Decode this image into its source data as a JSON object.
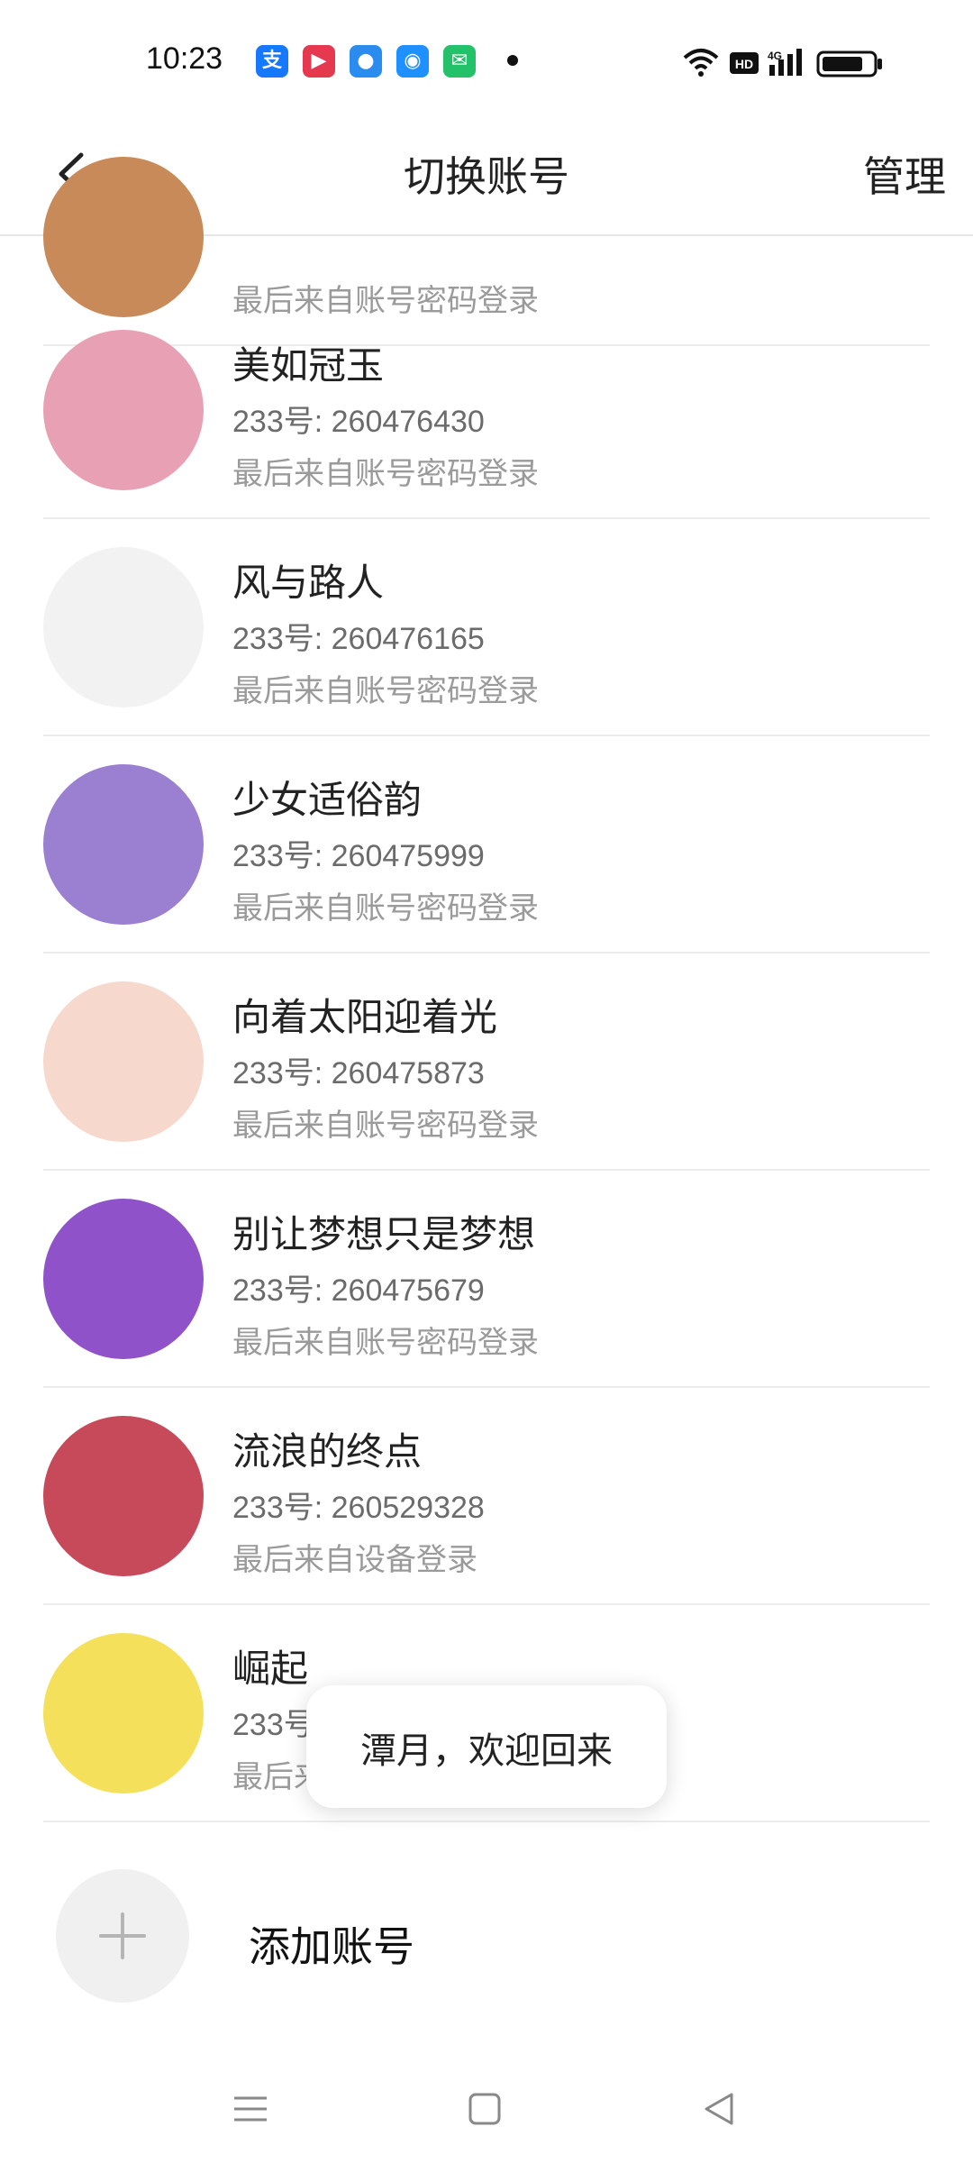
{
  "status_bar": {
    "time": "10:23",
    "apps": [
      {
        "name": "alipay-icon",
        "color": "#1677ff",
        "glyph": "支"
      },
      {
        "name": "video-app-icon",
        "color": "#e53950",
        "glyph": "▶"
      },
      {
        "name": "dot-app-icon",
        "color": "#2b8cf0",
        "glyph": "●"
      },
      {
        "name": "browser-app-icon",
        "color": "#1e90ff",
        "glyph": "◉"
      },
      {
        "name": "chat-app-icon",
        "color": "#24c16b",
        "glyph": "✉"
      }
    ],
    "network": "4G",
    "hd": "HD"
  },
  "header": {
    "title": "切换账号",
    "manage_label": "管理"
  },
  "accounts": [
    {
      "name": "",
      "uid": "",
      "last_login": "最后来自账号密码登录",
      "avatar_color": "#c98a5a"
    },
    {
      "name": "美如冠玉",
      "uid": "233号: 260476430",
      "last_login": "最后来自账号密码登录",
      "avatar_color": "#e8a0b4"
    },
    {
      "name": "风与路人",
      "uid": "233号: 260476165",
      "last_login": "最后来自账号密码登录",
      "avatar_color": "#f2f2f2"
    },
    {
      "name": "少女适俗韵",
      "uid": "233号: 260475999",
      "last_login": "最后来自账号密码登录",
      "avatar_color": "#9b7fd0"
    },
    {
      "name": "向着太阳迎着光",
      "uid": "233号: 260475873",
      "last_login": "最后来自账号密码登录",
      "avatar_color": "#f6d8cc"
    },
    {
      "name": "别让梦想只是梦想",
      "uid": "233号: 260475679",
      "last_login": "最后来自账号密码登录",
      "avatar_color": "#8f52c8"
    },
    {
      "name": "流浪的终点",
      "uid": "233号: 260529328",
      "last_login": "最后来自设备登录",
      "avatar_color": "#c74a5a"
    },
    {
      "name": "崛起",
      "uid": "233号",
      "last_login": "最后来",
      "avatar_color": "#f4e05a"
    }
  ],
  "toast": {
    "text": "潭月，欢迎回来"
  },
  "add_account": {
    "label": "添加账号",
    "plus": "+"
  },
  "colors": {
    "divider": "#ececec",
    "primary_text": "#222222",
    "secondary_text": "#9a9a9a"
  }
}
